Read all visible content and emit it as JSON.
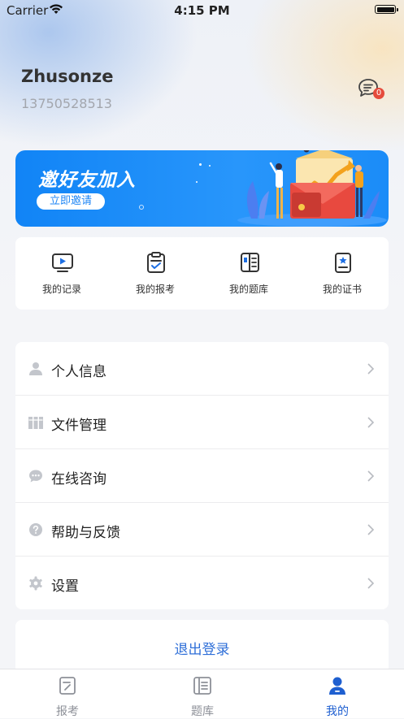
{
  "status_bar": {
    "carrier": "Carrier",
    "time": "4:15 PM"
  },
  "profile": {
    "username": "Zhusonze",
    "phone": "13750528513",
    "message_icon": "chat-icon",
    "unread_count": "0"
  },
  "banner": {
    "title": "邀好友加入",
    "button_label": "立即邀请"
  },
  "quick_actions": [
    {
      "label": "我的记录",
      "icon": "video-record-icon"
    },
    {
      "label": "我的报考",
      "icon": "clipboard-icon"
    },
    {
      "label": "我的题库",
      "icon": "notebook-icon"
    },
    {
      "label": "我的证书",
      "icon": "certificate-icon"
    }
  ],
  "menu": [
    {
      "label": "个人信息",
      "icon": "person-icon"
    },
    {
      "label": "文件管理",
      "icon": "folder-binders-icon"
    },
    {
      "label": "在线咨询",
      "icon": "chat-bubble-icon"
    },
    {
      "label": "帮助与反馈",
      "icon": "help-icon"
    },
    {
      "label": "设置",
      "icon": "gear-icon"
    }
  ],
  "logout_label": "退出登录",
  "tabbar": [
    {
      "label": "报考",
      "icon": "exam-tab-icon",
      "active": false
    },
    {
      "label": "题库",
      "icon": "question-bank-tab-icon",
      "active": false
    },
    {
      "label": "我的",
      "icon": "profile-tab-icon",
      "active": true
    }
  ],
  "colors": {
    "accent": "#1e5fd0",
    "banner": "#1a8af8",
    "badge": "#e54b3c",
    "icon_gray": "#c3c6cc"
  }
}
